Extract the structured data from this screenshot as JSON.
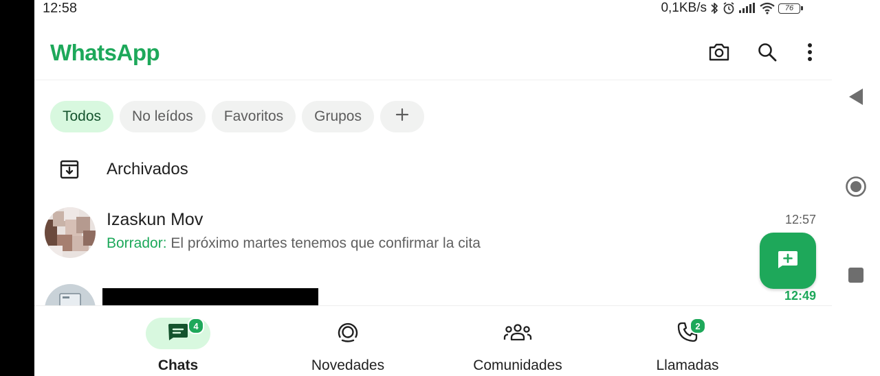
{
  "status_bar": {
    "time": "12:58",
    "network_speed": "0,1KB/s",
    "battery_level": "76",
    "icons": [
      "bluetooth-icon",
      "alarm-icon",
      "signal-icon",
      "wifi-icon",
      "battery-icon"
    ]
  },
  "app_bar": {
    "title": "WhatsApp",
    "actions": [
      "camera-icon",
      "search-icon",
      "more-vert-icon"
    ]
  },
  "filters": {
    "chips": [
      {
        "label": "Todos",
        "active": true
      },
      {
        "label": "No leídos",
        "active": false
      },
      {
        "label": "Favoritos",
        "active": false
      },
      {
        "label": "Grupos",
        "active": false
      },
      {
        "label": "+",
        "active": false
      }
    ]
  },
  "archived": {
    "label": "Archivados",
    "icon": "archive-icon"
  },
  "chats": [
    {
      "name": "Izaskun Mov",
      "draft_label": "Borrador:",
      "preview": "El próximo martes tenemos que confirmar la cita",
      "time": "12:57"
    },
    {
      "name": "",
      "time": "12:49",
      "unread": true
    }
  ],
  "fab": {
    "icon": "new-chat-icon"
  },
  "bottom_nav": {
    "items": [
      {
        "label": "Chats",
        "badge": "4",
        "icon": "chats-icon",
        "active": true
      },
      {
        "label": "Novedades",
        "badge": "",
        "icon": "updates-icon",
        "active": false
      },
      {
        "label": "Comunidades",
        "badge": "",
        "icon": "communities-icon",
        "active": false
      },
      {
        "label": "Llamadas",
        "badge": "2",
        "icon": "phone-icon",
        "active": false
      }
    ]
  },
  "colors": {
    "accent": "#1da85a",
    "chip_active_bg": "#d8f8df",
    "chip_bg": "#f1f2f1",
    "text_primary": "#1f1f1f",
    "text_secondary": "#5f5f5f"
  }
}
